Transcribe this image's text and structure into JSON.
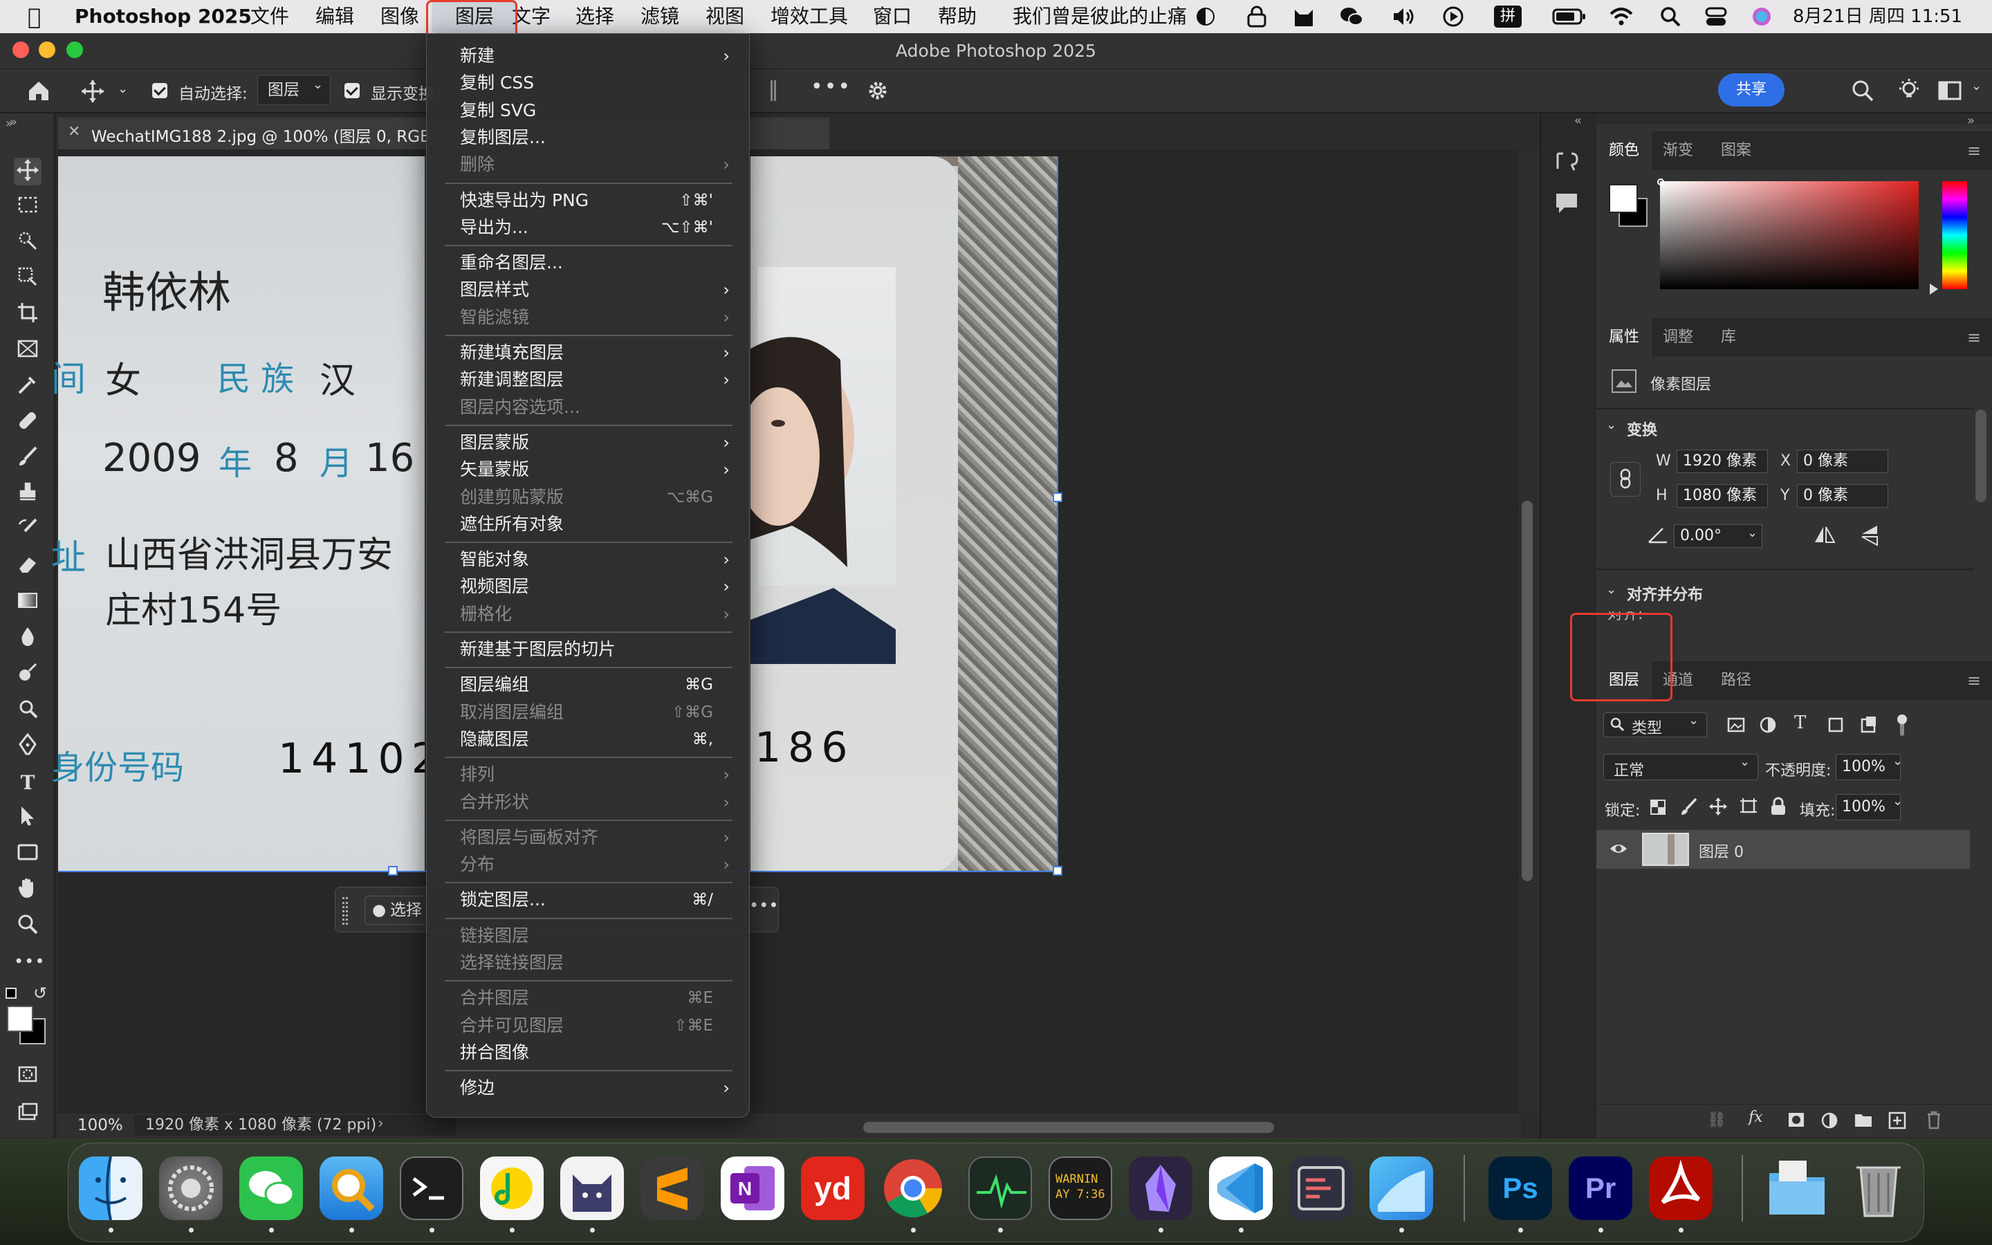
{
  "menubar": {
    "app_name": "Photoshop 2025",
    "menus": [
      "文件",
      "编辑",
      "图像",
      "图层",
      "文字",
      "选择",
      "滤镜",
      "视图",
      "增效工具",
      "窗口",
      "帮助"
    ],
    "now_playing": "我们曾是彼此的止痛",
    "input_method": "拼",
    "datetime": "8月21日 周四  11:51",
    "icons": [
      "apple-icon",
      "music-icon",
      "lock-icon",
      "cat-icon",
      "wechat-icon",
      "volume-icon",
      "play-icon",
      "input-icon",
      "battery-icon",
      "wifi-icon",
      "search-icon",
      "control-center-icon",
      "siri-icon"
    ]
  },
  "window": {
    "title": "Adobe Photoshop 2025"
  },
  "options_bar": {
    "auto_select_label": "自动选择:",
    "auto_select_value": "图层",
    "show_transform_label": "显示变换",
    "share_label": "共享"
  },
  "document": {
    "tab_title": "WechatIMG188 2.jpg @ 100% (图层 0, RGB",
    "zoom": "100%",
    "status": "1920 像素 x 1080 像素 (72 ppi)",
    "context_bar_label": "选择"
  },
  "id_card": {
    "name": "韩依林",
    "sex": "女",
    "ethnicity_label": "民  族",
    "ethnicity": "汉",
    "birth_year": "2009",
    "year_label": "年",
    "birth_month": "8",
    "month_label": "月",
    "birth_day": "16",
    "address_line1": "山西省洪洞县万安",
    "address_line2": "庄村154号",
    "id_label": "身份号码",
    "id_number_left": "14102",
    "id_number_right": "186",
    "left_edge_glyph_1": "间",
    "left_edge_glyph_2": "址"
  },
  "layer_menu": {
    "groups": [
      [
        {
          "label": "新建",
          "submenu": true
        },
        {
          "label": "复制 CSS"
        },
        {
          "label": "复制 SVG"
        },
        {
          "label": "复制图层..."
        },
        {
          "label": "删除",
          "submenu": true,
          "disabled": true
        }
      ],
      [
        {
          "label": "快速导出为 PNG",
          "shortcut": "⇧⌘'"
        },
        {
          "label": "导出为...",
          "shortcut": "⌥⇧⌘'"
        }
      ],
      [
        {
          "label": "重命名图层..."
        },
        {
          "label": "图层样式",
          "submenu": true
        },
        {
          "label": "智能滤镜",
          "submenu": true,
          "disabled": true
        }
      ],
      [
        {
          "label": "新建填充图层",
          "submenu": true
        },
        {
          "label": "新建调整图层",
          "submenu": true
        },
        {
          "label": "图层内容选项...",
          "disabled": true
        }
      ],
      [
        {
          "label": "图层蒙版",
          "submenu": true
        },
        {
          "label": "矢量蒙版",
          "submenu": true
        },
        {
          "label": "创建剪贴蒙版",
          "shortcut": "⌥⌘G",
          "disabled": true
        },
        {
          "label": "遮住所有对象"
        }
      ],
      [
        {
          "label": "智能对象",
          "submenu": true
        },
        {
          "label": "视频图层",
          "submenu": true
        },
        {
          "label": "栅格化",
          "submenu": true,
          "disabled": true
        }
      ],
      [
        {
          "label": "新建基于图层的切片"
        }
      ],
      [
        {
          "label": "图层编组",
          "shortcut": "⌘G"
        },
        {
          "label": "取消图层编组",
          "shortcut": "⇧⌘G",
          "disabled": true
        },
        {
          "label": "隐藏图层",
          "shortcut": "⌘,"
        }
      ],
      [
        {
          "label": "排列",
          "submenu": true,
          "disabled": true
        },
        {
          "label": "合并形状",
          "submenu": true,
          "disabled": true
        }
      ],
      [
        {
          "label": "将图层与画板对齐",
          "submenu": true,
          "disabled": true
        },
        {
          "label": "分布",
          "submenu": true,
          "disabled": true
        }
      ],
      [
        {
          "label": "锁定图层...",
          "shortcut": "⌘/"
        }
      ],
      [
        {
          "label": "链接图层",
          "disabled": true
        },
        {
          "label": "选择链接图层",
          "disabled": true
        }
      ],
      [
        {
          "label": "合并图层",
          "shortcut": "⌘E",
          "disabled": true
        },
        {
          "label": "合并可见图层",
          "shortcut": "⇧⌘E",
          "disabled": true
        },
        {
          "label": "拼合图像"
        }
      ],
      [
        {
          "label": "修边",
          "submenu": true
        }
      ]
    ]
  },
  "color_panel": {
    "tabs": [
      "颜色",
      "渐变",
      "图案"
    ]
  },
  "properties_panel": {
    "tabs": [
      "属性",
      "调整",
      "库"
    ],
    "layer_type": "像素图层",
    "transform_heading": "变换",
    "w_label": "W",
    "w_value": "1920 像素",
    "h_label": "H",
    "h_value": "1080 像素",
    "x_label": "X",
    "x_value": "0 像素",
    "y_label": "Y",
    "y_value": "0 像素",
    "angle_value": "0.00°",
    "align_heading": "对齐并分布",
    "align_partial": "对齐:"
  },
  "layers_panel": {
    "tabs": [
      "图层",
      "通道",
      "路径"
    ],
    "filter_kind": "类型",
    "blend_mode": "正常",
    "opacity_label": "不透明度:",
    "opacity_value": "100%",
    "lock_label": "锁定:",
    "fill_label": "填充:",
    "fill_value": "100%",
    "layers": [
      {
        "name": "图层 0",
        "visible": true
      }
    ]
  },
  "dock": {
    "apps": [
      "Finder",
      "系统设置",
      "微信",
      "预览",
      "终端",
      "QQ音乐",
      "CatGPT",
      "Sublime Text",
      "OneNote",
      "有道",
      "Chrome",
      "活动监视器",
      "控制台",
      "Obsidian",
      "VS Code",
      "Code Editor",
      "Preview Map",
      "Photoshop",
      "Premiere Pro",
      "Acrobat",
      "Downloads",
      "废纸篓"
    ],
    "console_text": "WARNIN\nAY 7:36"
  },
  "colors": {
    "highlight_red": "#e63b2e",
    "share_blue": "#2f6fe6",
    "ps_blue": "#31a8ff",
    "pr_purple": "#9999ff"
  }
}
